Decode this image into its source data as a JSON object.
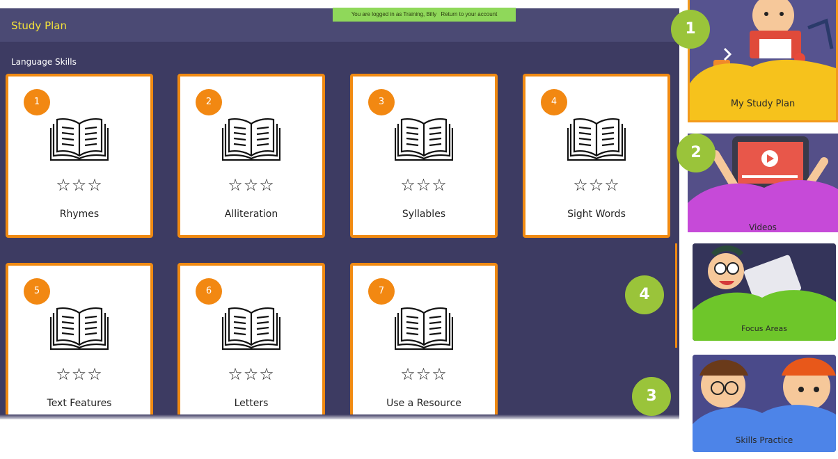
{
  "header": {
    "title": "Study Plan"
  },
  "login_banner": {
    "message": "You are logged in as Training, Billy",
    "link": "Return to your account"
  },
  "section": {
    "label": "Language Skills"
  },
  "cards": [
    {
      "number": "1",
      "label": "Rhymes",
      "stars": "☆☆☆"
    },
    {
      "number": "2",
      "label": "Alliteration",
      "stars": "☆☆☆"
    },
    {
      "number": "3",
      "label": "Syllables",
      "stars": "☆☆☆"
    },
    {
      "number": "4",
      "label": "Sight Words",
      "stars": "☆☆☆"
    },
    {
      "number": "5",
      "label": "Text Features",
      "stars": "☆☆☆"
    },
    {
      "number": "6",
      "label": "Letters",
      "stars": "☆☆☆"
    },
    {
      "number": "7",
      "label": "Use a Resource",
      "stars": "☆☆☆"
    }
  ],
  "sidebar": {
    "panels": [
      {
        "label": "My Study Plan",
        "color": "#f9c21a"
      },
      {
        "label": "Videos",
        "color": "#c24ad6"
      },
      {
        "label": "Focus Areas",
        "color": "#6cc62a"
      },
      {
        "label": "Skills Practice",
        "color": "#4d84e8"
      }
    ],
    "badges": [
      "1",
      "2",
      "4",
      "3"
    ]
  },
  "colors": {
    "background": "#3d3b62",
    "header": "#4b4a74",
    "title": "#f3e23a",
    "card_border": "#f08a12",
    "card_badge": "#f28812",
    "callout_badge": "#9ac43a",
    "banner": "#8fd85a"
  }
}
